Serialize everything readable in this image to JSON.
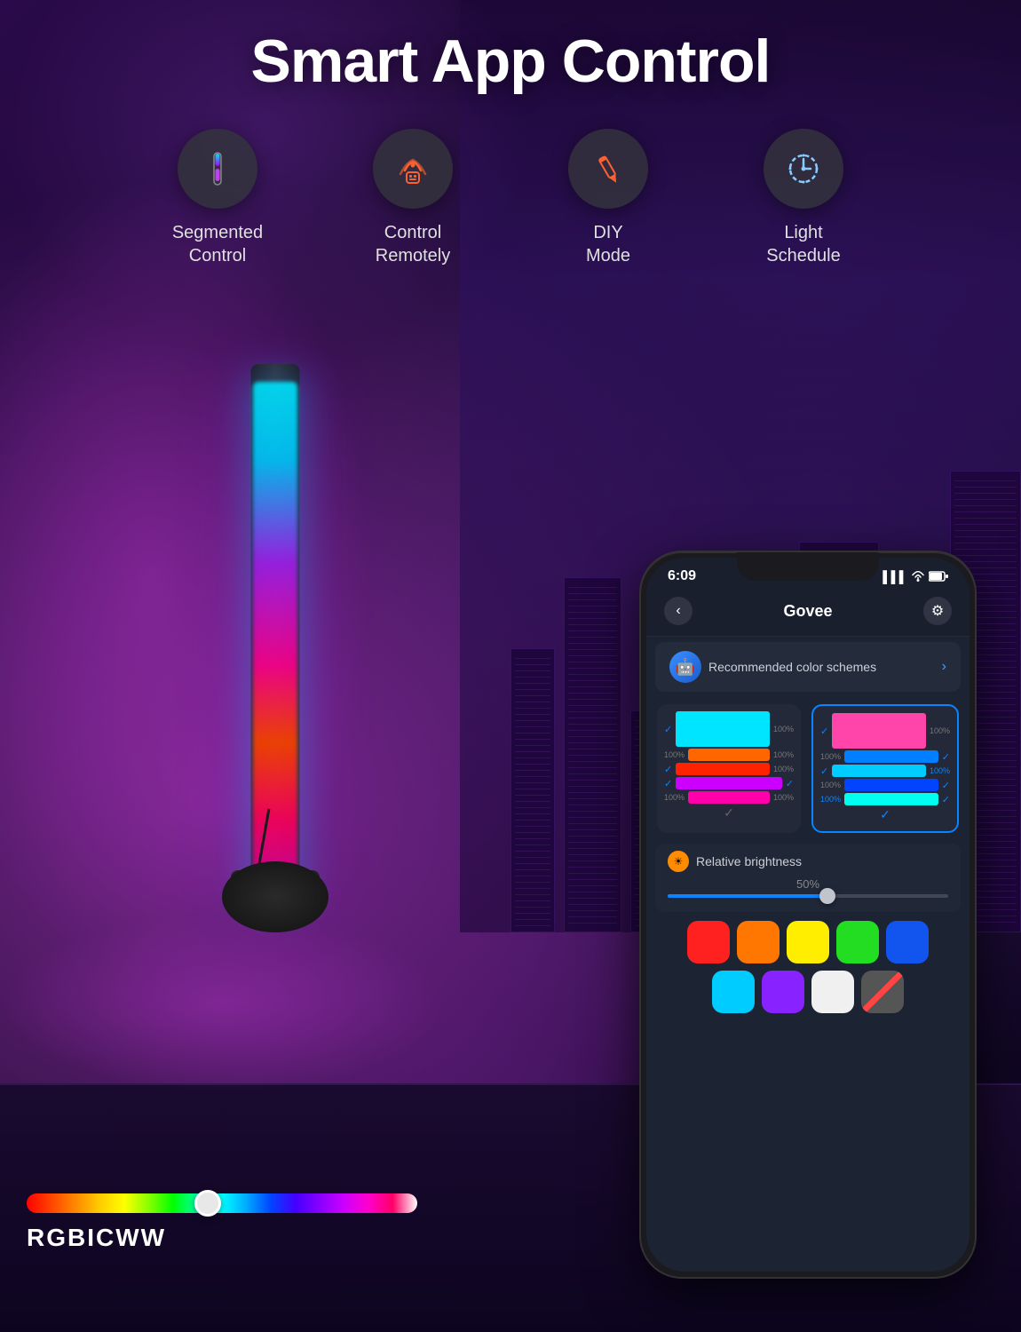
{
  "header": {
    "title": "Smart App Control"
  },
  "features": [
    {
      "id": "segmented-control",
      "label": "Segmented\nControl",
      "icon_type": "light-bar-icon"
    },
    {
      "id": "control-remotely",
      "label": "Control\nRemotely",
      "icon_type": "remote-icon"
    },
    {
      "id": "diy-mode",
      "label": "DIY\nMode",
      "icon_type": "pencil-icon"
    },
    {
      "id": "light-schedule",
      "label": "Light\nSchedule",
      "icon_type": "clock-icon"
    }
  ],
  "rgbicww_label": "RGBICWW",
  "phone": {
    "status_bar": {
      "time": "6:09",
      "signal": "▌▌▌",
      "wifi": "WiFi",
      "battery": "🔋"
    },
    "app_name": "Govee",
    "recommended_label": "Recommended color schemes",
    "robot_emoji": "🤖",
    "brightness_label": "Relative brightness",
    "brightness_pct": "50%",
    "color_rows_left": [
      {
        "check": true,
        "pct_left": "",
        "color": "cyan",
        "pct_right": "100%"
      },
      {
        "check": false,
        "pct_left": "100%",
        "color": "orange",
        "pct_right": "100%"
      },
      {
        "check": false,
        "pct_left": "",
        "color": "red",
        "pct_right": "100%"
      },
      {
        "check": false,
        "pct_left": "",
        "color": "magenta",
        "pct_right": ""
      },
      {
        "check": false,
        "pct_left": "100%",
        "color": "pink",
        "pct_right": "100%"
      }
    ],
    "color_rows_right": [
      {
        "check": false,
        "pct_left": "",
        "color": "pink",
        "pct_right": "100%"
      },
      {
        "check": false,
        "pct_left": "100%",
        "color": "blue2",
        "pct_right": ""
      },
      {
        "check": true,
        "pct_left": "",
        "color": "cyan2",
        "pct_right": "100%"
      },
      {
        "check": false,
        "pct_left": "100%",
        "color": "blue3",
        "pct_right": ""
      },
      {
        "check": true,
        "pct_left": "100%",
        "color": "cyan3",
        "pct_right": ""
      }
    ],
    "palette_row1": [
      "red",
      "orange",
      "yellow",
      "green",
      "blue"
    ],
    "palette_row2": [
      "cyan",
      "purple",
      "white",
      "none"
    ]
  }
}
